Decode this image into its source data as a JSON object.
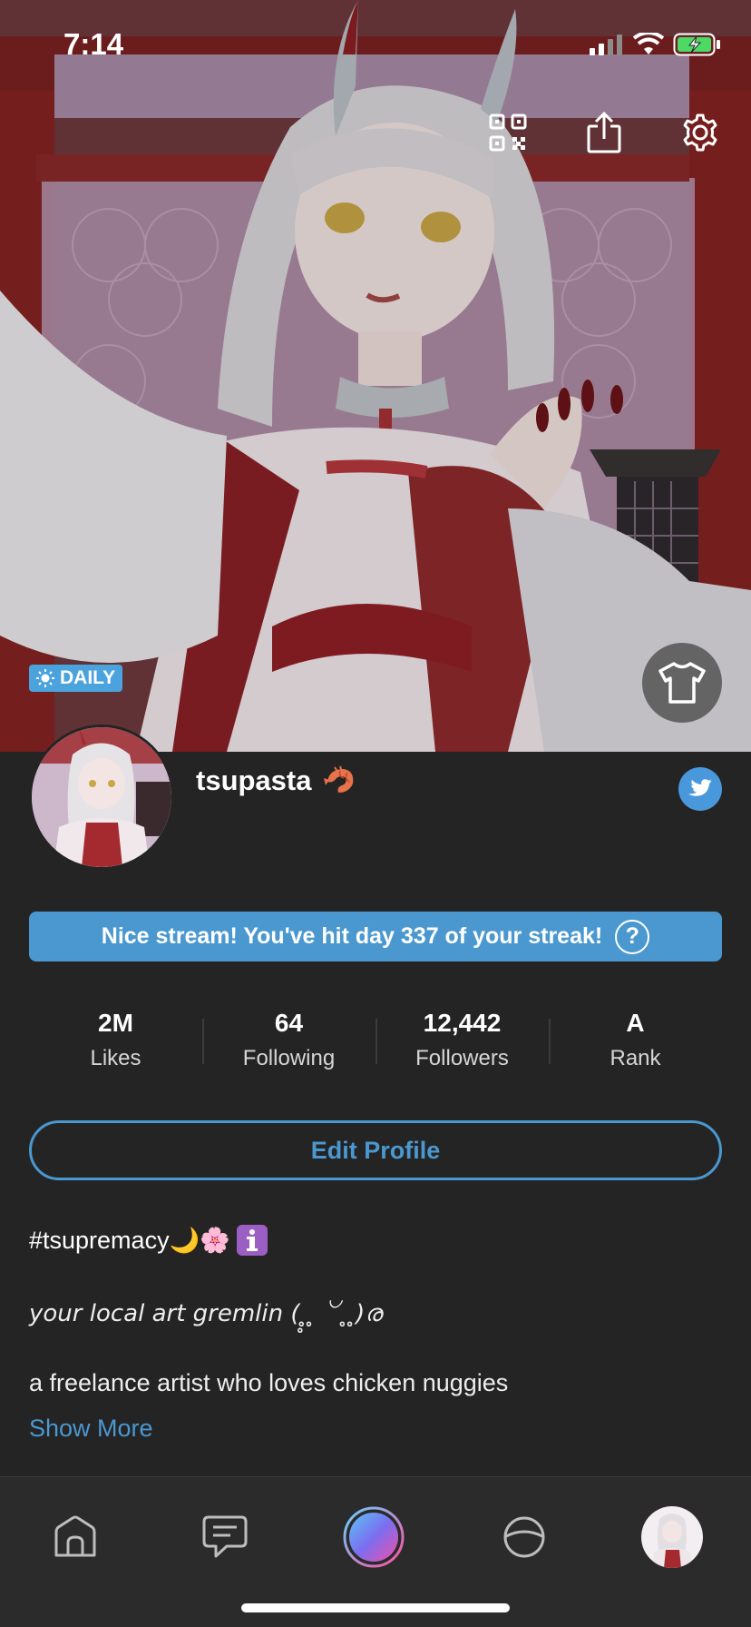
{
  "status": {
    "time": "7:14"
  },
  "hero": {
    "daily_label": "DAILY"
  },
  "profile": {
    "username": "tsupasta"
  },
  "streak": {
    "message": "Nice stream! You've hit day 337 of your streak!",
    "help": "?"
  },
  "stats": [
    {
      "value": "2M",
      "label": "Likes"
    },
    {
      "value": "64",
      "label": "Following"
    },
    {
      "value": "12,442",
      "label": "Followers"
    },
    {
      "value": "A",
      "label": "Rank"
    }
  ],
  "edit_profile_label": "Edit Profile",
  "bio": {
    "line1": "#tsupremacy🌙🌸",
    "line2": "your local art gremlin ( ̥̥ ̥ ꒡ ̥ ̥)ര",
    "line3": "a freelance artist who loves chicken nuggies",
    "tail": "‚‚‚"
  },
  "show_more_label": "Show More",
  "icons": {
    "qr": "qr-code-icon",
    "share": "share-icon",
    "settings": "gear-icon",
    "outfit": "shirt-icon",
    "twitter": "twitter-icon",
    "tabs": [
      "home-icon",
      "chat-icon",
      "live-icon",
      "explore-icon",
      "profile-avatar"
    ]
  },
  "colors": {
    "accent": "#4a98cf",
    "background": "#242424",
    "tabbar": "#2b2b2b"
  }
}
